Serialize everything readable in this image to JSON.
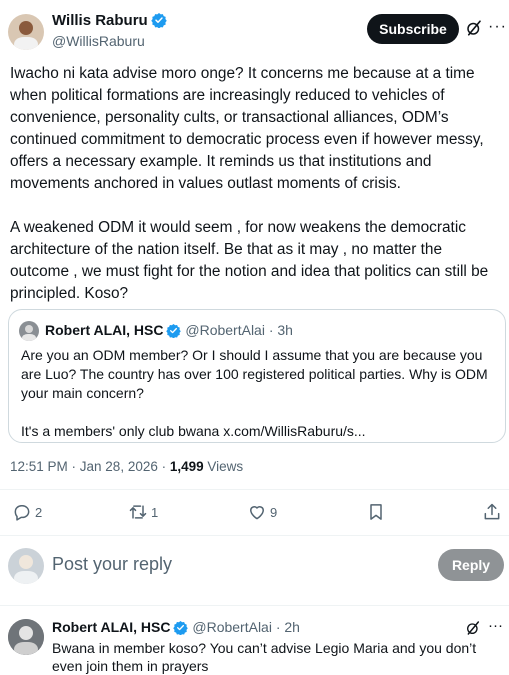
{
  "tweet": {
    "author": {
      "name": "Willis Raburu",
      "handle": "@WillisRaburu",
      "verified": true
    },
    "subscribe_label": "Subscribe",
    "more_label": "···",
    "body": {
      "p1": "Iwacho ni kata advise moro onge? It concerns me because at  a time when political formations are increasingly reduced to vehicles of convenience, personality cults, or transactional alliances, ODM’s continued commitment to democratic process even if however messy, offers a necessary example. It reminds us that institutions and movements anchored in values outlast moments of crisis.",
      "p2": "A weakened ODM it would seem , for now weakens the democratic architecture of the nation itself. Be that as it may , no matter the outcome , we must fight for the notion and idea that politics can still be principled. Koso?"
    },
    "quote": {
      "name": "Robert ALAI, HSC",
      "handle_time": "@RobertAlai · 3h",
      "p1": "Are you an ODM member? Or I should I assume that you are because you are Luo? The country has over 100 registered political parties. Why is ODM your main concern?",
      "p2": "It's a members' only club bwana x.com/WillisRaburu/s..."
    },
    "timestamp": "12:51 PM · Jan 28, 2026 · ",
    "views_count": "1,499",
    "views_label": " Views",
    "actions": {
      "replies": "2",
      "reposts": "1",
      "likes": "9"
    }
  },
  "reply_box": {
    "placeholder": "Post your reply",
    "button_label": "Reply"
  },
  "comment": {
    "name": "Robert ALAI, HSC",
    "handle_time": "@RobertAlai · 2h",
    "text": "Bwana in member koso? You can’t advise Legio Maria and you don’t even join them in prayers",
    "more_label": "···"
  },
  "colors": {
    "verified_blue": "#1d9bf0",
    "text": "#0f1419",
    "muted": "#536471",
    "border": "#cfd9de"
  }
}
